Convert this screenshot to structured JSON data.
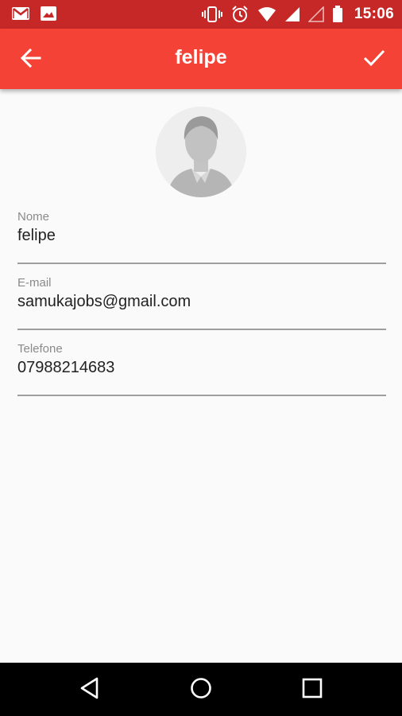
{
  "status_bar": {
    "time": "15:06",
    "icons": [
      "gmail-icon",
      "image-icon",
      "vibrate-icon",
      "alarm-icon",
      "wifi-icon",
      "signal-icon",
      "signal-empty-icon",
      "battery-icon"
    ]
  },
  "app_bar": {
    "title": "felipe",
    "back_icon": "arrow-back-icon",
    "confirm_icon": "check-icon",
    "color": "#f44336"
  },
  "avatar": {
    "icon": "person-placeholder-icon"
  },
  "form": {
    "name": {
      "label": "Nome",
      "value": "felipe"
    },
    "email": {
      "label": "E-mail",
      "value": "samukajobs@gmail.com"
    },
    "phone": {
      "label": "Telefone",
      "value": "07988214683"
    }
  },
  "nav_bar": {
    "icons": [
      "back-triangle-icon",
      "home-circle-icon",
      "recents-square-icon"
    ]
  },
  "colors": {
    "status_bar": "#c62828",
    "app_bar": "#f44336",
    "background": "#fafafa",
    "underline": "#9e9e9e"
  }
}
